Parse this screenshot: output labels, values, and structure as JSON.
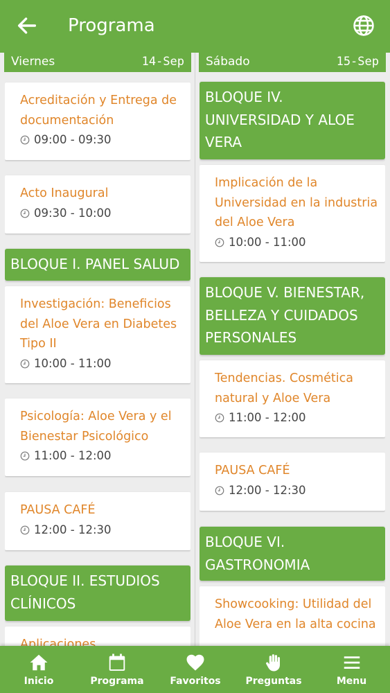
{
  "appbar": {
    "title": "Programa",
    "back_icon": "arrow-left-icon",
    "language_icon": "globe-icon"
  },
  "days": {
    "left": {
      "name": "Viernes",
      "date": "14-Sep"
    },
    "right": {
      "name": "Sábado",
      "date": "15-Sep"
    }
  },
  "left_column": [
    {
      "kind": "session",
      "title": "Acreditación y Entrega de documentación",
      "time": "09:00 - 09:30"
    },
    {
      "kind": "session",
      "title": "Acto Inaugural",
      "time": "09:30 - 10:00"
    },
    {
      "kind": "block",
      "title": "BLOQUE I. PANEL SALUD"
    },
    {
      "kind": "session",
      "title": "Investigación: Beneficios del Aloe Vera en Diabetes Tipo II",
      "time": "10:00 - 11:00"
    },
    {
      "kind": "session",
      "title": "Psicología: Aloe Vera y el Bienestar Psicológico",
      "time": "11:00 - 12:00"
    },
    {
      "kind": "session",
      "title": "PAUSA CAFÉ",
      "time": "12:00 - 12:30"
    },
    {
      "kind": "block",
      "title": "BLOQUE II. ESTUDIOS CLÍNICOS"
    },
    {
      "kind": "session",
      "title": "Aplicaciones",
      "time": ""
    }
  ],
  "right_column": [
    {
      "kind": "block",
      "title": "BLOQUE IV. UNIVERSIDAD Y ALOE VERA"
    },
    {
      "kind": "session",
      "title": "Implicación de la Universidad en la industria del Aloe Vera",
      "time": "10:00 - 11:00"
    },
    {
      "kind": "block",
      "title": "BLOQUE V. BIENESTAR, BELLEZA Y CUIDADOS PERSONALES"
    },
    {
      "kind": "session",
      "title": "Tendencias. Cosmética natural y Aloe Vera",
      "time": "11:00 - 12:00"
    },
    {
      "kind": "session",
      "title": "PAUSA CAFÉ",
      "time": "12:00 - 12:30"
    },
    {
      "kind": "block",
      "title": "BLOQUE VI. GASTRONOMIA"
    },
    {
      "kind": "session",
      "title": "Showcooking: Utilidad del Aloe Vera en la alta cocina",
      "time": ""
    }
  ],
  "bottom_nav": [
    {
      "label": "Inicio",
      "icon": "home-icon"
    },
    {
      "label": "Programa",
      "icon": "calendar-icon"
    },
    {
      "label": "Favoritos",
      "icon": "heart-icon"
    },
    {
      "label": "Preguntas",
      "icon": "hand-icon"
    },
    {
      "label": "Menu",
      "icon": "menu-icon"
    }
  ],
  "colors": {
    "primary": "#6aad44",
    "session_title": "#e0862a",
    "background": "#ededed"
  }
}
